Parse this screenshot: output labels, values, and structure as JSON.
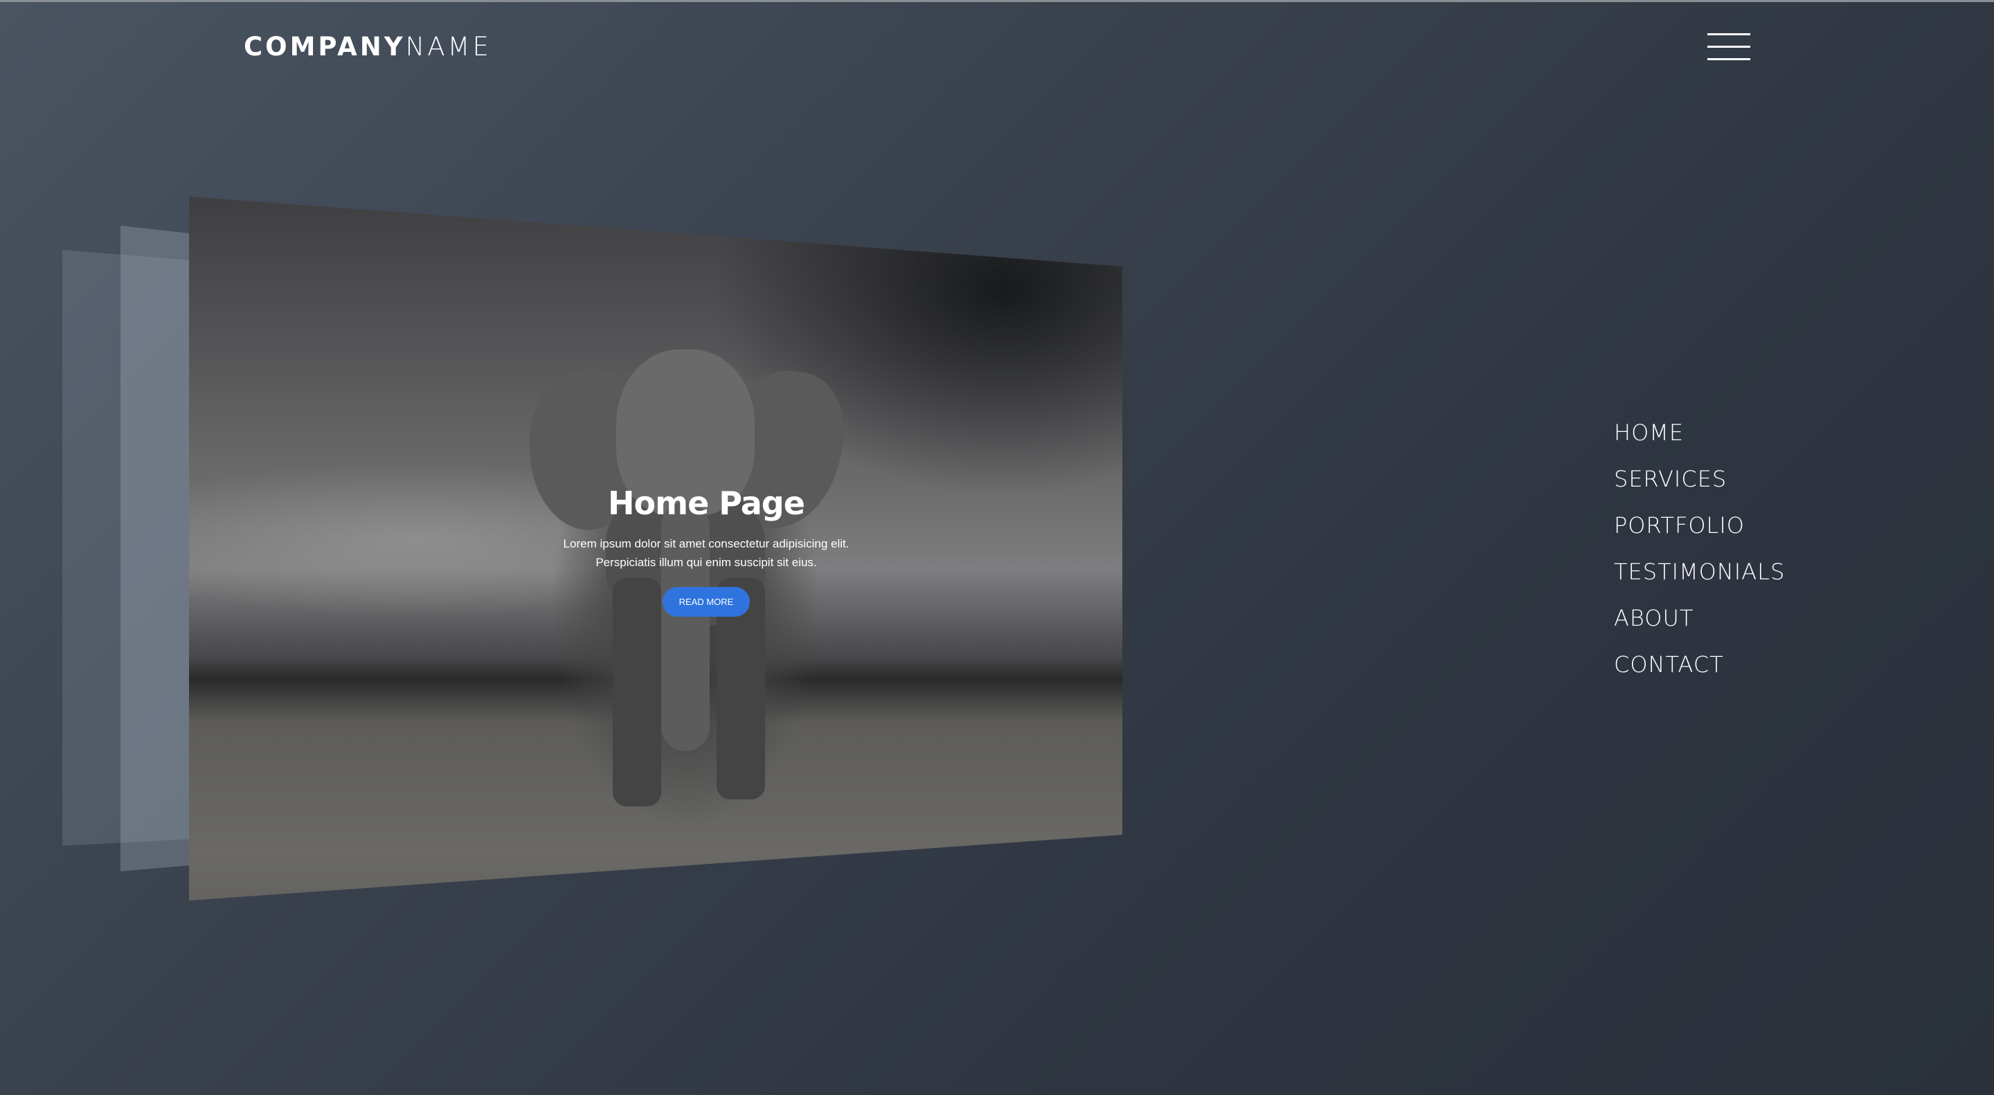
{
  "header": {
    "logo_bold": "COMPANY",
    "logo_light": "NAME",
    "menu_icon": "hamburger-menu-icon"
  },
  "hero": {
    "title": "Home Page",
    "text_line1": "Lorem ipsum dolor sit amet consectetur adipisicing elit.",
    "text_line2": "Perspiciatis illum qui enim suscipit sit eius.",
    "button_label": "READ MORE",
    "button_color": "#2f74de"
  },
  "nav": {
    "items": [
      {
        "label": "HOME"
      },
      {
        "label": "SERVICES"
      },
      {
        "label": "PORTFOLIO"
      },
      {
        "label": "TESTIMONIALS"
      },
      {
        "label": "ABOUT"
      },
      {
        "label": "CONTACT"
      }
    ]
  }
}
